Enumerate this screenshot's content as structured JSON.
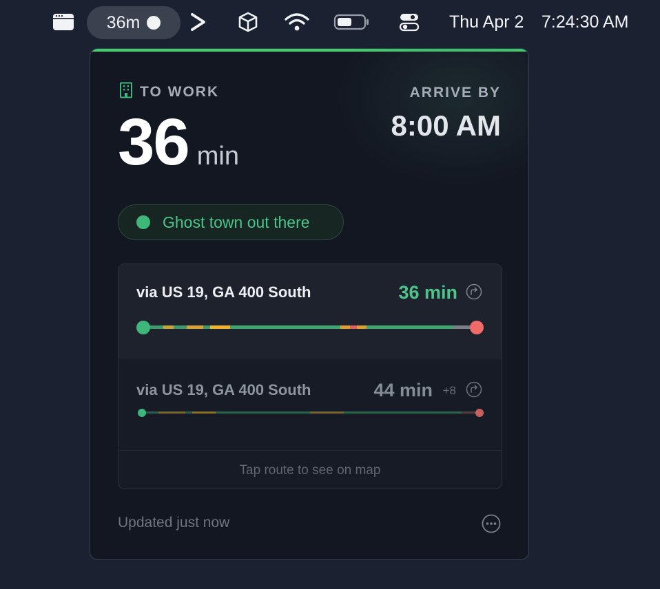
{
  "menubar": {
    "pill_label": "36m",
    "date": "Thu Apr 2",
    "time": "7:24:30 AM",
    "icons": [
      "menu-window-icon",
      "chevron-right-icon",
      "cube-icon",
      "wifi-icon",
      "battery-icon",
      "control-center-icon"
    ]
  },
  "panel": {
    "destination_label": "TO WORK",
    "destination_icon": "building-icon",
    "duration_value": "36",
    "duration_unit": "min",
    "arrive_label": "ARRIVE BY",
    "arrive_time": "8:00 AM",
    "status_text": "Ghost town out there",
    "status_color": "#3fb67a",
    "accent_color": "#3ecf6e",
    "routes": [
      {
        "name": "via US 19, GA 400 South",
        "time": "36 min",
        "delta": "",
        "selected": true,
        "segments": [
          {
            "start": 0.0,
            "end": 0.06,
            "color": "#3e9a6c"
          },
          {
            "start": 0.06,
            "end": 0.09,
            "color": "#c9a23a"
          },
          {
            "start": 0.09,
            "end": 0.13,
            "color": "#3e9a6c"
          },
          {
            "start": 0.13,
            "end": 0.18,
            "color": "#d6a334"
          },
          {
            "start": 0.18,
            "end": 0.2,
            "color": "#3e9a6c"
          },
          {
            "start": 0.2,
            "end": 0.26,
            "color": "#f0b429"
          },
          {
            "start": 0.26,
            "end": 0.59,
            "color": "#3fa56e"
          },
          {
            "start": 0.59,
            "end": 0.62,
            "color": "#d9a030"
          },
          {
            "start": 0.62,
            "end": 0.64,
            "color": "#e06060"
          },
          {
            "start": 0.64,
            "end": 0.67,
            "color": "#d9a030"
          },
          {
            "start": 0.67,
            "end": 0.93,
            "color": "#3fa56e"
          },
          {
            "start": 0.93,
            "end": 1.0,
            "color": "#7a7f88"
          }
        ],
        "start_color": "#3fb67a",
        "end_color": "#f06a6a"
      },
      {
        "name": "via US 19, GA 400 South",
        "time": "44 min",
        "delta": "+8",
        "selected": false,
        "segments": [
          {
            "start": 0.0,
            "end": 0.05,
            "color": "#3e9a6c"
          },
          {
            "start": 0.05,
            "end": 0.13,
            "color": "#c9a23a"
          },
          {
            "start": 0.13,
            "end": 0.15,
            "color": "#3e9a6c"
          },
          {
            "start": 0.15,
            "end": 0.22,
            "color": "#f0b429"
          },
          {
            "start": 0.22,
            "end": 0.5,
            "color": "#3fa56e"
          },
          {
            "start": 0.5,
            "end": 0.6,
            "color": "#c9a23a"
          },
          {
            "start": 0.6,
            "end": 0.95,
            "color": "#3fa56e"
          },
          {
            "start": 0.95,
            "end": 1.0,
            "color": "#8a5a5a"
          }
        ],
        "start_color": "#3fb67a",
        "end_color": "#c46060"
      }
    ],
    "routes_hint": "Tap route to see on map",
    "updated_text": "Updated just now"
  }
}
